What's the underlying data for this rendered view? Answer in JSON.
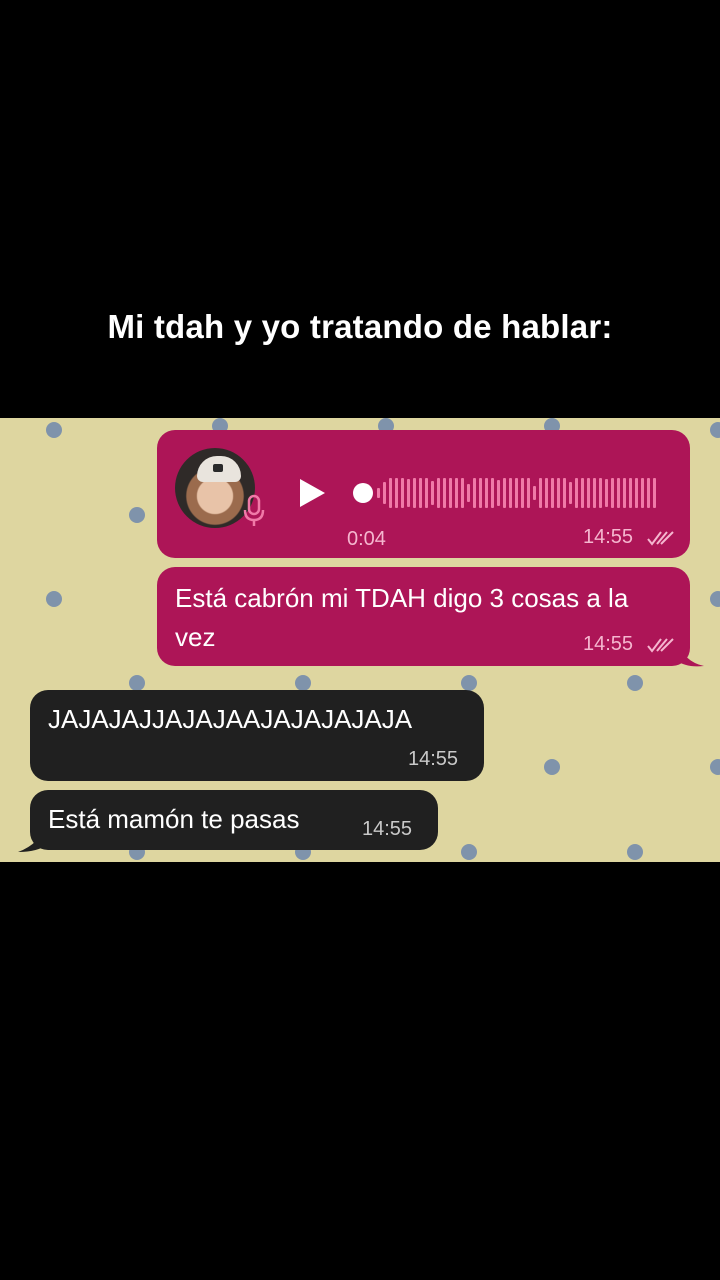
{
  "caption": "Mi tdah y yo tratando de hablar:",
  "colors": {
    "chat_background": "#ded6a0",
    "outgoing_bubble": "#ad1557",
    "incoming_bubble": "#202020",
    "pattern_dot": "#7f93ab"
  },
  "messages": {
    "voice": {
      "duration": "0:04",
      "time": "14:55",
      "status_icon": "double-check-icon"
    },
    "outgoing_text": {
      "text": "Está cabrón mi TDAH digo 3 cosas a la vez",
      "time": "14:55",
      "status_icon": "double-check-icon"
    },
    "incoming_1": {
      "text": "JAJAJAJJAJAJAAJAJAJAJAJA",
      "time": "14:55"
    },
    "incoming_2": {
      "text": "Está mamón te pasas",
      "time": "14:55"
    }
  }
}
